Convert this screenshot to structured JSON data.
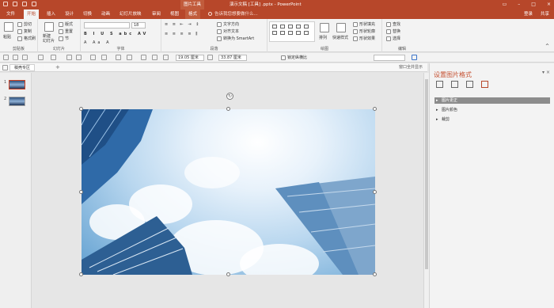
{
  "titlebar": {
    "context_tab": "图片工具",
    "title": "演示文稿 [工具] .pptx - PowerPoint",
    "window_controls": [
      "?",
      "▭",
      "–",
      "□",
      "×"
    ]
  },
  "tabs": {
    "items": [
      "文件",
      "开始",
      "插入",
      "设计",
      "切换",
      "动画",
      "幻灯片放映",
      "审阅",
      "视图",
      "格式"
    ],
    "active": "开始",
    "tell_me": "告诉我您想要做什么...",
    "login": "登录",
    "share": "共享"
  },
  "ribbon": {
    "clipboard": {
      "paste": "粘贴",
      "cut": "剪切",
      "copy": "复制",
      "format_painter": "格式刷",
      "label": "剪贴板"
    },
    "slides": {
      "new_slide": "新建\n幻灯片",
      "layout": "版式",
      "reset": "重置",
      "section": "节",
      "label": "幻灯片"
    },
    "font": {
      "label": "字体",
      "size": "18"
    },
    "paragraph": {
      "text_direction": "文字方向",
      "align_text": "对齐文本",
      "smartart": "转换为 SmartArt",
      "label": "段落"
    },
    "drawing": {
      "arrange": "排列",
      "quick_styles": "快速样式",
      "fill": "形状填充",
      "outline": "形状轮廓",
      "effects": "形状效果",
      "label": "绘图"
    },
    "editing": {
      "find": "查找",
      "replace": "替换",
      "select": "选择",
      "label": "编辑"
    }
  },
  "toolbar2": {
    "width_value": "19.05 厘米",
    "height_value": "33.87 厘米",
    "lock_aspect": "锁定纵横比"
  },
  "docbar": {
    "tab_label": "稿壳专区",
    "right_label": "窗口全并显示"
  },
  "thumbnails": [
    {
      "num": "1",
      "selected": true
    },
    {
      "num": "2",
      "selected": false
    }
  ],
  "pane": {
    "title": "设置图片格式",
    "controls": "▾ ×",
    "icons": [
      "fill-line-icon",
      "effects-icon",
      "size-icon",
      "picture-icon"
    ],
    "sections": [
      {
        "label": "图片更正",
        "highlighted": true
      },
      {
        "label": "图片颜色",
        "highlighted": false
      },
      {
        "label": "裁剪",
        "highlighted": false
      }
    ]
  },
  "colors": {
    "accent": "#b7472a",
    "ribbon_bg": "#f3f3f3",
    "selection": "#d04424"
  }
}
